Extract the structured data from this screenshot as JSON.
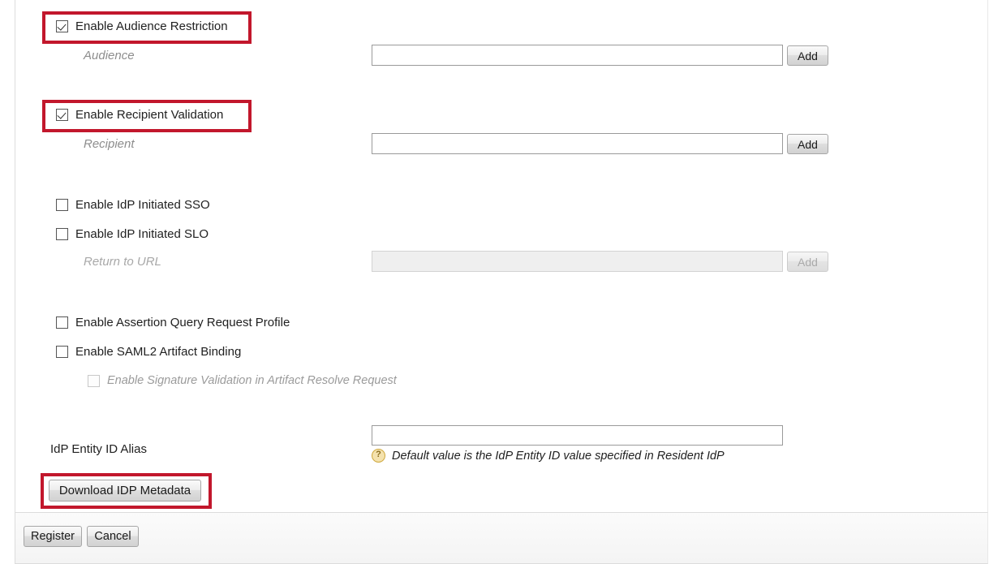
{
  "form": {
    "checkboxes": [
      {
        "label": "Enable Audience Restriction",
        "checked": true,
        "disabled": false,
        "highlighted": true
      },
      {
        "label": "Enable Recipient Validation",
        "checked": true,
        "disabled": false,
        "highlighted": true
      },
      {
        "label": "Enable IdP Initiated SSO",
        "checked": false,
        "disabled": false,
        "highlighted": false
      },
      {
        "label": "Enable IdP Initiated SLO",
        "checked": false,
        "disabled": false,
        "highlighted": false
      },
      {
        "label": "Enable Assertion Query Request Profile",
        "checked": false,
        "disabled": false,
        "highlighted": false
      },
      {
        "label": "Enable SAML2 Artifact Binding",
        "checked": false,
        "disabled": false,
        "highlighted": false
      },
      {
        "label": "Enable Signature Validation in Artifact Resolve Request",
        "checked": false,
        "disabled": true,
        "highlighted": false
      }
    ],
    "fields": [
      {
        "label": "Audience",
        "value": "",
        "placeholder": "",
        "disabled": false,
        "button_label": "Add",
        "button_disabled": false
      },
      {
        "label": "Recipient",
        "value": "",
        "placeholder": "",
        "disabled": false,
        "button_label": "Add",
        "button_disabled": false
      },
      {
        "label": "Return to URL",
        "value": "",
        "placeholder": "",
        "disabled": true,
        "button_label": "Add",
        "button_disabled": true
      }
    ],
    "alias": {
      "label": "IdP Entity ID Alias",
      "value": "",
      "placeholder": "",
      "hint": "Default value is the IdP Entity ID value specified in Resident IdP",
      "hint_icon": "help-circle-icon"
    },
    "download_button": {
      "label": "Download IDP Metadata",
      "highlighted": true
    }
  },
  "footer": {
    "register_label": "Register",
    "cancel_label": "Cancel"
  },
  "colors": {
    "highlight": "#c2172c",
    "text": "#212121",
    "muted": "#8d8d8d",
    "hint_icon_bg": "#f4e2ae"
  }
}
